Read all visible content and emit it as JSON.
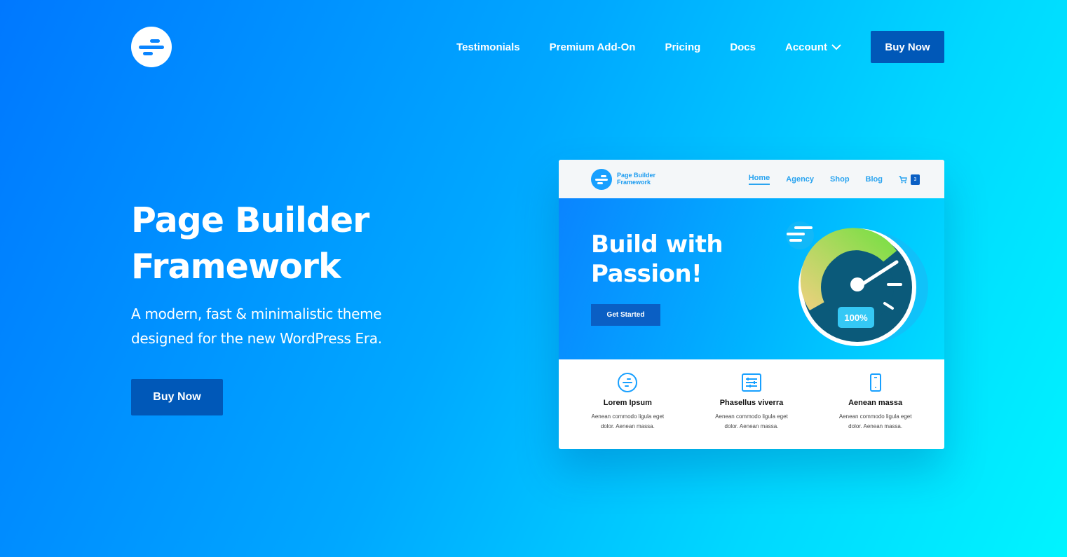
{
  "header": {
    "logo": "page-builder-framework-logo",
    "nav": [
      {
        "label": "Testimonials"
      },
      {
        "label": "Premium Add-On"
      },
      {
        "label": "Pricing"
      },
      {
        "label": "Docs"
      },
      {
        "label": "Account",
        "icon": "chevron-down-icon"
      }
    ],
    "buy_label": "Buy Now"
  },
  "hero": {
    "title_line1": "Page Builder",
    "title_line2": "Framework",
    "subtitle_line1": "A modern, fast & minimalistic theme",
    "subtitle_line2": "designed for the new WordPress Era.",
    "buy_label": "Buy Now"
  },
  "mockup": {
    "brand_line1": "Page Builder",
    "brand_line2": "Framework",
    "nav": [
      {
        "label": "Home",
        "active": true
      },
      {
        "label": "Agency"
      },
      {
        "label": "Shop"
      },
      {
        "label": "Blog"
      }
    ],
    "cart_count": "3",
    "title_line1": "Build with",
    "title_line2": "Passion!",
    "cta_label": "Get Started",
    "gauge_label": "100%",
    "features": [
      {
        "icon": "logo-circle-icon",
        "title": "Lorem Ipsum",
        "line1": "Aenean commodo ligula eget",
        "line2": "dolor. Aenean massa."
      },
      {
        "icon": "sliders-icon",
        "title": "Phasellus viverra",
        "line1": "Aenean commodo ligula eget",
        "line2": "dolor. Aenean massa."
      },
      {
        "icon": "mobile-icon",
        "title": "Aenean massa",
        "line1": "Aenean commodo ligula eget",
        "line2": "dolor. Aenean massa."
      }
    ]
  },
  "colors": {
    "gradient_start": "#0078ff",
    "gradient_end": "#00f4ff",
    "button": "#0058b8",
    "accent": "#18a0ff"
  }
}
